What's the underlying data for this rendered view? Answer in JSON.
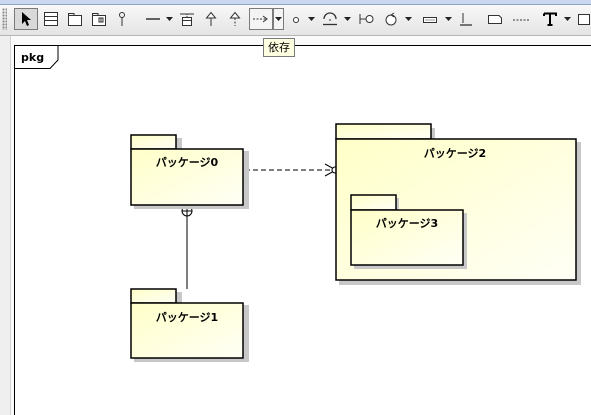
{
  "toolbar": {
    "tools": [
      {
        "name": "select-tool",
        "icon": "arrow-pointer-icon"
      },
      {
        "name": "class-tool",
        "icon": "class-icon"
      },
      {
        "name": "package-tool",
        "icon": "package-icon"
      },
      {
        "name": "subsystem-tool",
        "icon": "subsystem-icon"
      },
      {
        "name": "model-tool",
        "icon": "pin-icon"
      },
      {
        "name": "association-tool",
        "icon": "line-icon"
      },
      {
        "name": "association-class-tool",
        "icon": "association-class-icon"
      },
      {
        "name": "generalization-tool",
        "icon": "hollow-arrow-icon"
      },
      {
        "name": "realization-tool",
        "icon": "dashed-hollow-arrow-icon"
      },
      {
        "name": "dependency-tool",
        "icon": "dashed-arrow-icon"
      },
      {
        "name": "interface-tool",
        "icon": "circle-icon"
      },
      {
        "name": "required-interface-tool",
        "icon": "socket-icon"
      },
      {
        "name": "port-tool",
        "icon": "lollipop-icon"
      },
      {
        "name": "control-tool",
        "icon": "control-icon"
      },
      {
        "name": "note-tool",
        "icon": "note-icon"
      },
      {
        "name": "anchor-tool",
        "icon": "anchor-icon"
      },
      {
        "name": "rectangle-tool",
        "icon": "rectangle-icon"
      },
      {
        "name": "line-tool",
        "icon": "dotted-line-icon"
      },
      {
        "name": "text-tool",
        "icon": "text-icon"
      },
      {
        "name": "frame-tool",
        "icon": "frame-icon"
      }
    ]
  },
  "tooltip": "依存",
  "frame": {
    "label": "pkg"
  },
  "packages": {
    "p0": "パッケージ0",
    "p1": "パッケージ1",
    "p2": "パッケージ2",
    "p3": "パッケージ3"
  },
  "colors": {
    "package_fill": "#ffffcc",
    "package_fill_light": "#fffff4",
    "outline": "#000000",
    "tooltip_bg": "#ffffe1"
  }
}
